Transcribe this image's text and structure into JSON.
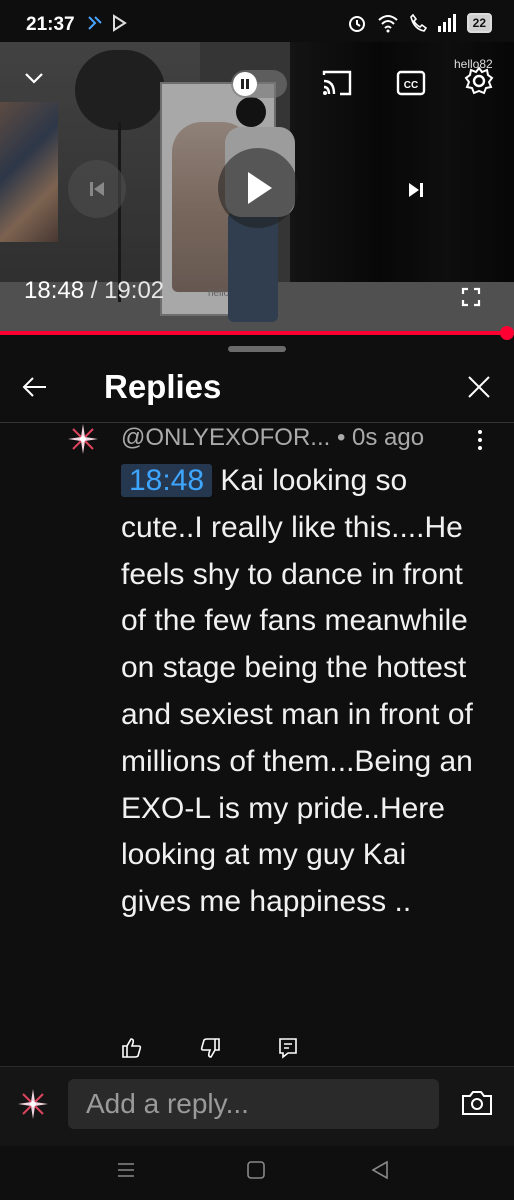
{
  "status_bar": {
    "time": "21:37",
    "battery": "22"
  },
  "player": {
    "current_time": "18:48",
    "separator": " / ",
    "duration": "19:02",
    "progress": 0.987,
    "watermark": "hello82",
    "board_text": "hello"
  },
  "replies_panel": {
    "title": "Replies"
  },
  "comment": {
    "author": "@ONLYEXOFOR...",
    "age": "• 0s ago",
    "timestamp_link": "18:48",
    "text": " Kai looking so cute..I really like this....He feels shy to dance in front of the few fans meanwhile on stage being the hottest and sexiest man in front of millions of them...Being an EXO-L is my pride..Here looking at my guy Kai gives me happiness .."
  },
  "reply_box": {
    "placeholder": "Add a reply..."
  },
  "colors": {
    "accent": "#ff0033",
    "link": "#3ea6ff",
    "background": "#0f0f0f"
  },
  "icons": [
    "chevron-down-icon",
    "pause-icon",
    "cast-icon",
    "cc-icon",
    "gear-icon",
    "previous-icon",
    "play-icon",
    "next-icon",
    "fullscreen-icon",
    "back-arrow-icon",
    "close-icon",
    "more-vert-icon",
    "thumbs-up-icon",
    "thumbs-down-icon",
    "reply-icon",
    "camera-icon",
    "recents-icon",
    "home-icon",
    "back-icon"
  ]
}
